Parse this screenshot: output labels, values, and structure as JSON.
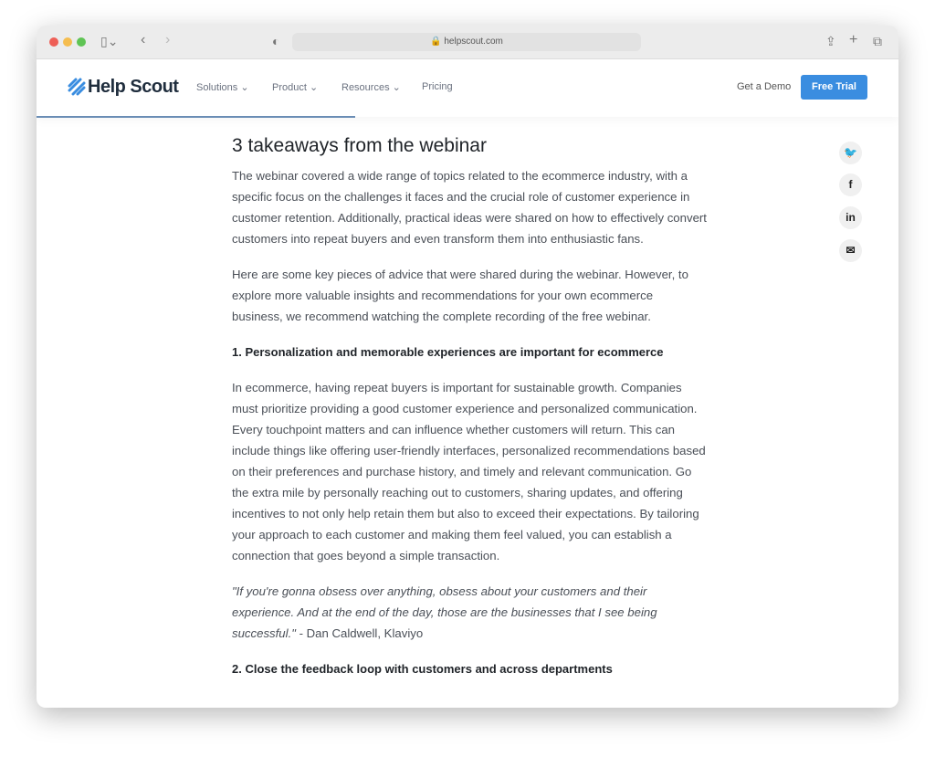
{
  "browser": {
    "url": "helpscout.com"
  },
  "nav": {
    "logo": "Help Scout",
    "items": [
      "Solutions",
      "Product",
      "Resources",
      "Pricing"
    ],
    "get_demo": "Get a Demo",
    "free_trial": "Free Trial"
  },
  "article": {
    "title": "3 takeaways from the webinar",
    "p1": "The webinar covered a wide range of topics related to the ecommerce industry, with a specific focus on the challenges it faces and the crucial role of customer experience in customer retention. Additionally, practical ideas were shared on how to effectively convert customers into repeat buyers and even transform them into enthusiastic fans.",
    "p2": "Here are some key pieces of advice that were shared during the webinar. However, to explore more valuable insights and recommendations for your own ecommerce business, we recommend watching the complete recording of the free webinar.",
    "h1": "1. Personalization and memorable experiences are important for ecommerce",
    "p3": "In ecommerce, having repeat buyers is important for sustainable growth. Companies must prioritize providing a good customer experience and personalized communication. Every touchpoint matters and can influence whether customers will return. This can include things like offering user-friendly interfaces, personalized recommendations based on their preferences and purchase history, and timely and relevant communication. Go the extra mile by personally reaching out to customers, sharing updates, and offering incentives to not only help retain them but also to exceed their expectations. By tailoring your approach to each customer and making them feel valued, you can establish a connection that goes beyond a simple transaction.",
    "quote": "\"If you're gonna obsess over anything, obsess about your customers and their experience. And at the end of the day, those are the businesses that I see being successful.\"",
    "quote_attr": " - Dan Caldwell, Klaviyo",
    "h2": "2. Close the feedback loop with customers and across departments"
  },
  "share": {
    "twitter": "🐦",
    "facebook": "f",
    "linkedin": "in",
    "email": "✉"
  },
  "colors": {
    "accent": "#3a8de0",
    "progress": "#6a8db5"
  },
  "reading_progress_fraction": 0.37
}
